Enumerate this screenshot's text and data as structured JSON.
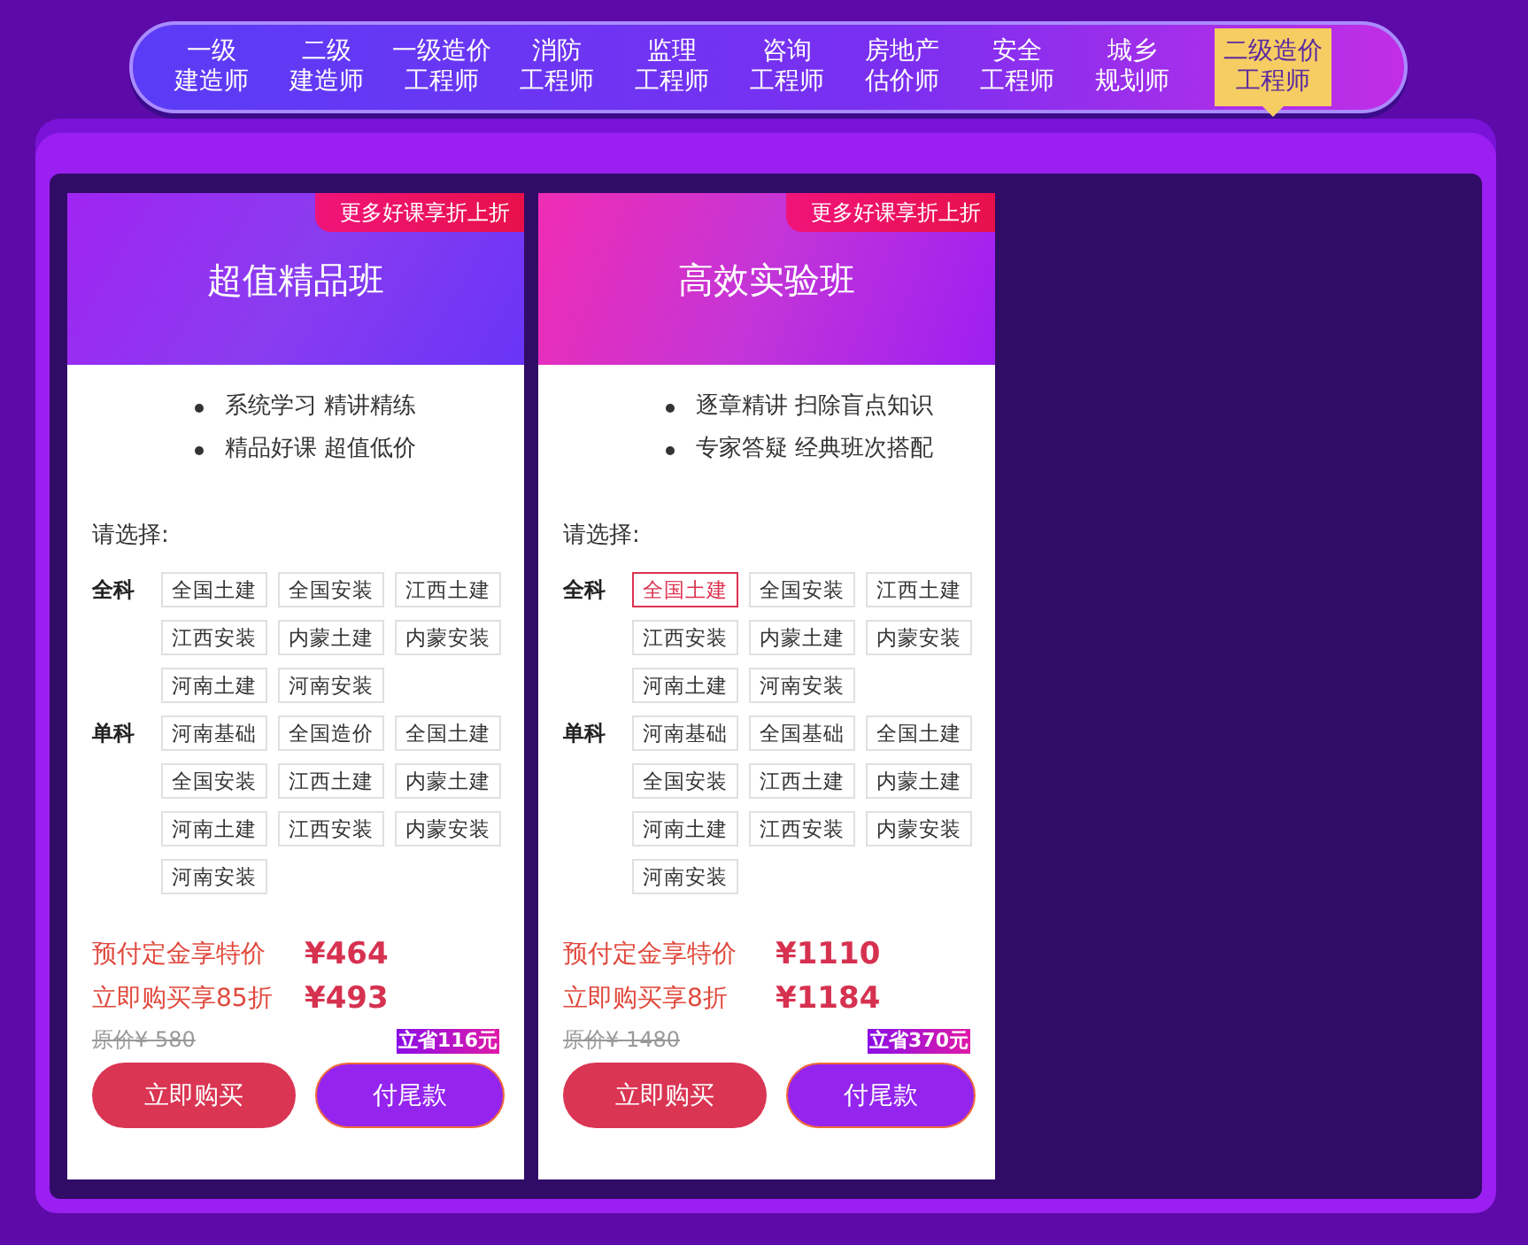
{
  "nav": {
    "items": [
      {
        "lines": [
          "一级",
          "建造师"
        ],
        "selected": false
      },
      {
        "lines": [
          "二级",
          "建造师"
        ],
        "selected": false
      },
      {
        "lines": [
          "一级造价",
          "工程师"
        ],
        "selected": false
      },
      {
        "lines": [
          "消防",
          "工程师"
        ],
        "selected": false
      },
      {
        "lines": [
          "监理",
          "工程师"
        ],
        "selected": false
      },
      {
        "lines": [
          "咨询",
          "工程师"
        ],
        "selected": false
      },
      {
        "lines": [
          "房地产",
          "估价师"
        ],
        "selected": false
      },
      {
        "lines": [
          "安全",
          "工程师"
        ],
        "selected": false
      },
      {
        "lines": [
          "城乡",
          "规划师"
        ],
        "selected": false
      },
      {
        "lines": [
          "二级造价",
          "工程师"
        ],
        "selected": true
      }
    ]
  },
  "cards": [
    {
      "kind": "violet",
      "badge": "更多好课享折上折",
      "title": "超值精品班",
      "features": [
        "系统学习 精讲精练",
        "精品好课 超值低价"
      ],
      "prompt": "请选择:",
      "groups": [
        {
          "label": "全科",
          "options": [
            {
              "label": "全国土建",
              "selected": false
            },
            {
              "label": "全国安装",
              "selected": false
            },
            {
              "label": "江西土建",
              "selected": false
            },
            {
              "label": "江西安装",
              "selected": false
            },
            {
              "label": "内蒙土建",
              "selected": false
            },
            {
              "label": "内蒙安装",
              "selected": false
            },
            {
              "label": "河南土建",
              "selected": false
            },
            {
              "label": "河南安装",
              "selected": false
            }
          ]
        },
        {
          "label": "单科",
          "options": [
            {
              "label": "河南基础",
              "selected": false
            },
            {
              "label": "全国造价",
              "selected": false
            },
            {
              "label": "全国土建",
              "selected": false
            },
            {
              "label": "全国安装",
              "selected": false
            },
            {
              "label": "江西土建",
              "selected": false
            },
            {
              "label": "内蒙土建",
              "selected": false
            },
            {
              "label": "河南土建",
              "selected": false
            },
            {
              "label": "江西安装",
              "selected": false
            },
            {
              "label": "内蒙安装",
              "selected": false
            },
            {
              "label": "河南安装",
              "selected": false
            }
          ]
        }
      ],
      "deposit_label": "预付定金享特价",
      "deposit_price": "¥464",
      "buy_label": "立即购买享85折",
      "buy_price": "¥493",
      "original_price": "原价¥ 580",
      "savings": "立省116元",
      "buy_button": "立即购买",
      "pay_button": "付尾款"
    },
    {
      "kind": "magenta",
      "badge": "更多好课享折上折",
      "title": "高效实验班",
      "features": [
        "逐章精讲 扫除盲点知识",
        "专家答疑 经典班次搭配"
      ],
      "prompt": "请选择:",
      "groups": [
        {
          "label": "全科",
          "options": [
            {
              "label": "全国土建",
              "selected": true
            },
            {
              "label": "全国安装",
              "selected": false
            },
            {
              "label": "江西土建",
              "selected": false
            },
            {
              "label": "江西安装",
              "selected": false
            },
            {
              "label": "内蒙土建",
              "selected": false
            },
            {
              "label": "内蒙安装",
              "selected": false
            },
            {
              "label": "河南土建",
              "selected": false
            },
            {
              "label": "河南安装",
              "selected": false
            }
          ]
        },
        {
          "label": "单科",
          "options": [
            {
              "label": "河南基础",
              "selected": false
            },
            {
              "label": "全国基础",
              "selected": false
            },
            {
              "label": "全国土建",
              "selected": false
            },
            {
              "label": "全国安装",
              "selected": false
            },
            {
              "label": "江西土建",
              "selected": false
            },
            {
              "label": "内蒙土建",
              "selected": false
            },
            {
              "label": "河南土建",
              "selected": false
            },
            {
              "label": "江西安装",
              "selected": false
            },
            {
              "label": "内蒙安装",
              "selected": false
            },
            {
              "label": "河南安装",
              "selected": false
            }
          ]
        }
      ],
      "deposit_label": "预付定金享特价",
      "deposit_price": "¥1110",
      "buy_label": "立即购买享8折",
      "buy_price": "¥1184",
      "original_price": "原价¥ 1480",
      "savings": "立省370元",
      "buy_button": "立即购买",
      "pay_button": "付尾款"
    }
  ]
}
